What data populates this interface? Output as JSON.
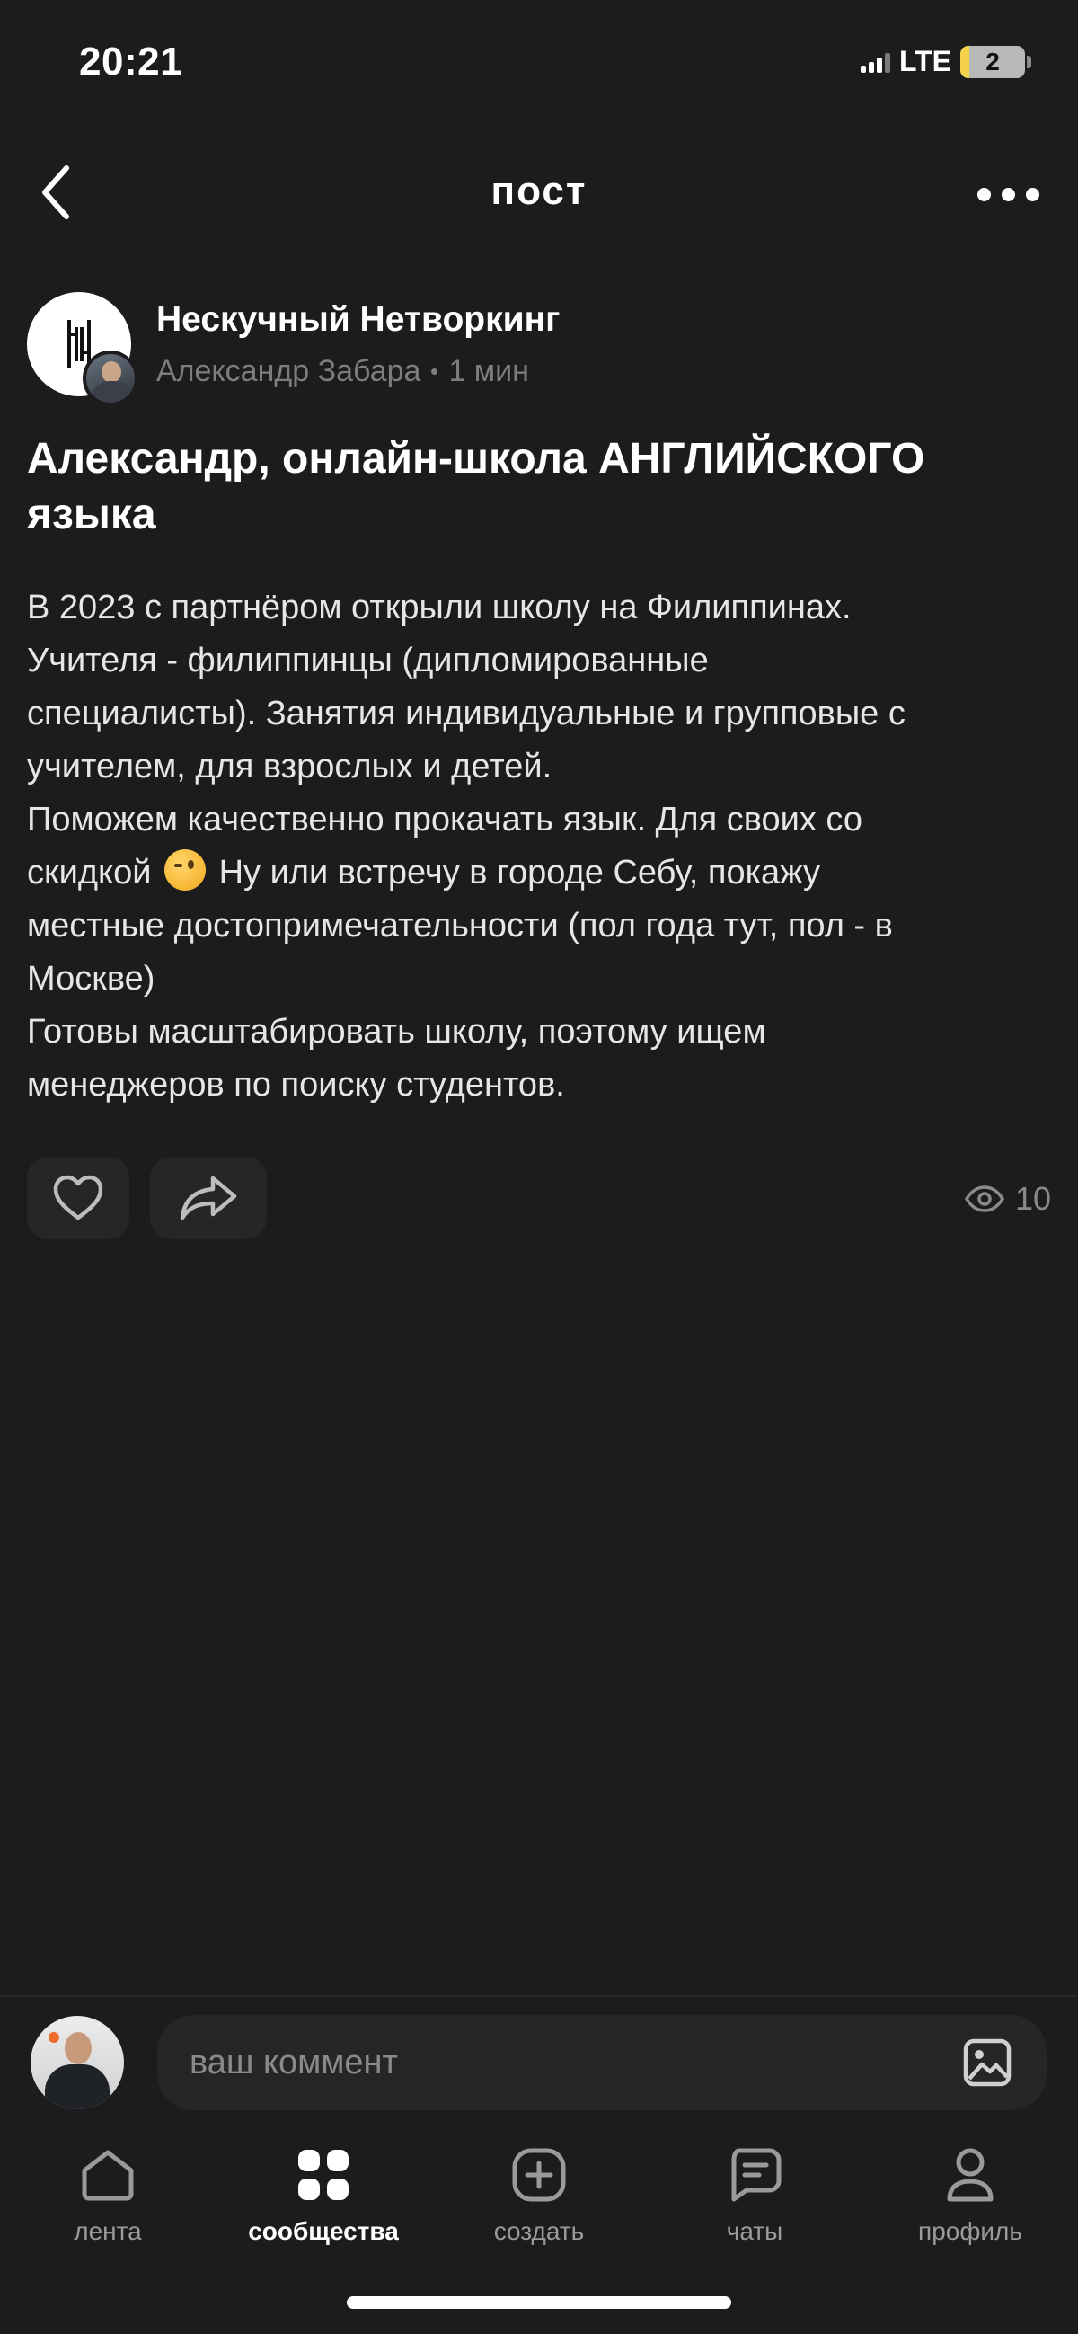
{
  "status_bar": {
    "time": "20:21",
    "network": "LTE",
    "battery": "2"
  },
  "header": {
    "title": "пост"
  },
  "post": {
    "community_name": "Нескучный Нетворкинг",
    "author": "Александр Забара",
    "time_ago": "1 мин",
    "title_lines": [
      "Александр, онлайн-школа АНГЛИЙСКОГО",
      "языка"
    ],
    "body_lines": {
      "l1": "В 2023 с партнёром открыли школу на Филиппинах.",
      "l2": "Учителя - филиппинцы (дипломированные",
      "l3": "специалисты). Занятия индивидуальные и групповые с",
      "l4": "учителем, для взрослых и детей.",
      "l5": "Поможем качественно прокачать язык. Для своих со",
      "l6a": "скидкой",
      "l6b": "Ну или встречу в городе Себу, покажу",
      "l7": "местные достопримечательности (пол года тут, пол - в",
      "l8": "Москве)",
      "l9": "Готовы масштабировать школу, поэтому ищем",
      "l10": "менеджеров по поиску студентов."
    },
    "views": "10"
  },
  "comment": {
    "placeholder": "ваш коммент"
  },
  "tabs": [
    {
      "label": "лента",
      "icon": "home-icon",
      "active": false
    },
    {
      "label": "сообщества",
      "icon": "grid-icon",
      "active": true
    },
    {
      "label": "создать",
      "icon": "plus-square-icon",
      "active": false
    },
    {
      "label": "чаты",
      "icon": "chat-icon",
      "active": false
    },
    {
      "label": "профиль",
      "icon": "person-icon",
      "active": false
    }
  ],
  "colors": {
    "background": "#1c1c1c",
    "surface": "#262626",
    "muted_text": "#7d7d7d",
    "accent_text": "#ffffff"
  }
}
